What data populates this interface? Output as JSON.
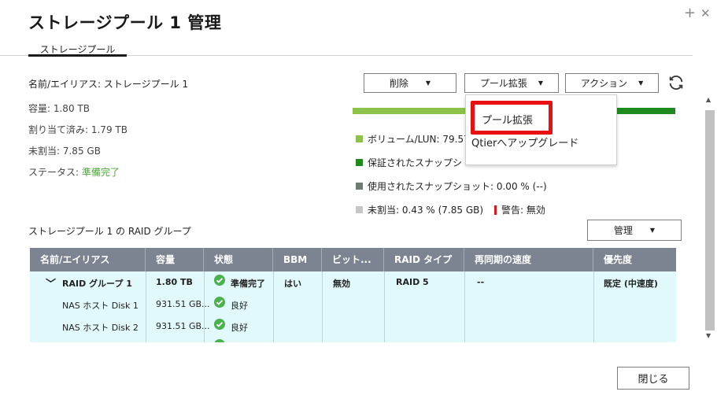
{
  "window": {
    "title": "ストレージプール 1 管理",
    "controls": {
      "expand": "+",
      "close": "✕"
    }
  },
  "tabs": [
    {
      "label": "ストレージプール"
    }
  ],
  "info": {
    "name_label": "名前/エイリアス: ストレージプール 1",
    "capacity": "容量:  1.80 TB",
    "allocated": "割り当て済み:  1.79 TB",
    "unallocated": "未割当:  7.85 GB",
    "status_label": "ステータス: ",
    "status_value": "準備完了"
  },
  "toolbar": {
    "delete_label": "削除",
    "expand_label": "プール拡張",
    "action_label": "アクション",
    "refresh_icon": "refresh-icon"
  },
  "dropdown": {
    "items": [
      {
        "label": "プール拡張"
      },
      {
        "label": "Qtierへアップグレード"
      }
    ]
  },
  "legend": {
    "volume": "ボリューム/LUN: 79.57",
    "guaranteed": "保証されたスナップシ",
    "used_snapshot": "使用されたスナップショット: 0.00 % (--)",
    "unallocated": "未割当: 0.43 % (7.85 GB)",
    "warning": "警告: 無効",
    "colors": {
      "volume": "#8bc34a",
      "guaranteed": "#1e8a1e",
      "used": "#6d7c70",
      "unallocated": "#c6c6c6",
      "warning": "#d21b1b"
    }
  },
  "raid_section": {
    "title": "ストレージプール 1 の RAID グループ",
    "manage_label": "管理"
  },
  "table": {
    "headers": [
      "名前/エイリアス",
      "容量",
      "状態",
      "BBM",
      "ビット...",
      "RAID タイプ",
      "再同期の速度",
      "優先度"
    ],
    "group_row": {
      "name": "RAID グループ 1",
      "capacity": "1.80 TB",
      "status": "準備完了",
      "bbm": "はい",
      "bitmap": "無効",
      "raid_type": "RAID 5",
      "resync": "--",
      "priority": "既定 (中速度)"
    },
    "disk_rows": [
      {
        "name": "NAS ホスト Disk 1",
        "capacity": "931.51 GB...",
        "status": "良好"
      },
      {
        "name": "NAS ホスト Disk 2",
        "capacity": "931.51 GB...",
        "status": "良好"
      }
    ]
  },
  "footer": {
    "close_label": "閉じる"
  }
}
